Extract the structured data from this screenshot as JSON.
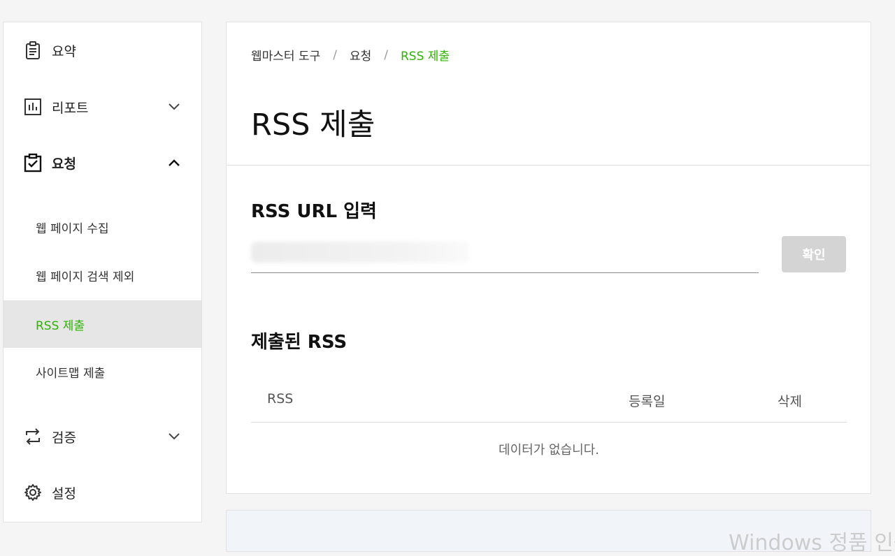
{
  "sidebar": {
    "items": [
      {
        "label": "요약",
        "icon": "summary-clipboard-icon"
      },
      {
        "label": "리포트",
        "icon": "report-chart-icon",
        "expanded": false
      },
      {
        "label": "요청",
        "icon": "request-check-icon",
        "expanded": true
      },
      {
        "label": "검증",
        "icon": "verify-swap-icon",
        "expanded": false
      },
      {
        "label": "설정",
        "icon": "settings-gear-icon"
      }
    ],
    "sub_items": [
      {
        "label": "웹 페이지 수집"
      },
      {
        "label": "웹 페이지 검색 제외"
      },
      {
        "label": "RSS 제출",
        "active": true
      },
      {
        "label": "사이트맵 제출"
      }
    ]
  },
  "breadcrumb": {
    "root": "웹마스터 도구",
    "section": "요청",
    "current": "RSS 제출",
    "separator": "/"
  },
  "page_title": "RSS 제출",
  "input_section": {
    "title": "RSS URL 입력",
    "input_value": "",
    "button_label": "확인"
  },
  "submitted_section": {
    "title": "제출된 RSS",
    "columns": [
      "RSS",
      "등록일",
      "삭제"
    ],
    "empty_message": "데이터가 없습니다."
  },
  "watermark": "Windows 정품 인증",
  "colors": {
    "accent": "#2db400",
    "active_bg": "#e6e6e6",
    "button_disabled": "#d4d4d4"
  }
}
